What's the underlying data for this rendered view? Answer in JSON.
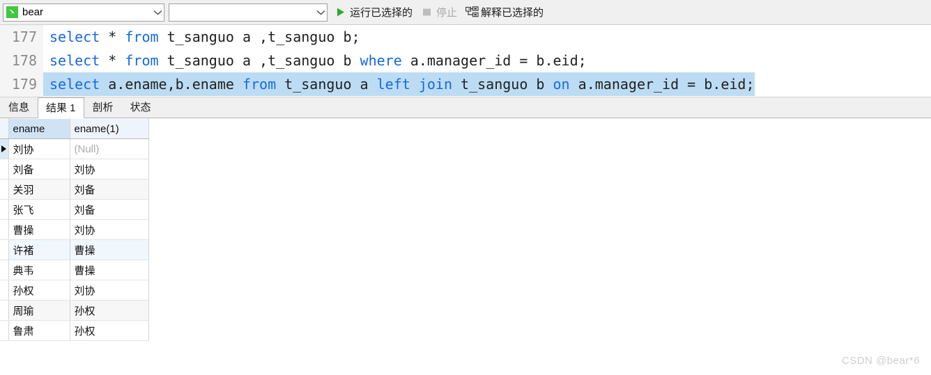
{
  "toolbar": {
    "connection": {
      "value": "bear",
      "icon": "dolphin-icon"
    },
    "database": {
      "value": "",
      "placeholder": ""
    },
    "run_selected": {
      "label": "运行已选择的",
      "icon": "play-icon"
    },
    "stop": {
      "label": "停止",
      "icon": "stop-icon",
      "disabled": true
    },
    "explain_selected": {
      "label": "解释已选择的",
      "icon": "explain-plan-icon"
    }
  },
  "editor": {
    "lines": [
      {
        "number": "177",
        "selected": false,
        "tokens": [
          {
            "t": "select",
            "k": true
          },
          {
            "t": " * ",
            "k": false
          },
          {
            "t": "from",
            "k": true
          },
          {
            "t": " t_sanguo a ,t_sanguo b;",
            "k": false
          }
        ],
        "text": "select * from t_sanguo a ,t_sanguo b;"
      },
      {
        "number": "178",
        "selected": false,
        "tokens": [
          {
            "t": "select",
            "k": true
          },
          {
            "t": " * ",
            "k": false
          },
          {
            "t": "from",
            "k": true
          },
          {
            "t": " t_sanguo a ,t_sanguo b ",
            "k": false
          },
          {
            "t": "where",
            "k": true
          },
          {
            "t": " a.manager_id = b.eid;",
            "k": false
          }
        ],
        "text": "select * from t_sanguo a ,t_sanguo b where a.manager_id = b.eid;"
      },
      {
        "number": "179",
        "selected": true,
        "tokens": [
          {
            "t": "select",
            "k": true
          },
          {
            "t": " a.ename,b.ename ",
            "k": false
          },
          {
            "t": "from",
            "k": true
          },
          {
            "t": " t_sanguo a ",
            "k": false
          },
          {
            "t": "left",
            "k": true
          },
          {
            "t": " ",
            "k": false
          },
          {
            "t": "join",
            "k": true
          },
          {
            "t": " t_sanguo b ",
            "k": false
          },
          {
            "t": "on",
            "k": true
          },
          {
            "t": " a.manager_id = b.eid;",
            "k": false
          }
        ],
        "text": "select a.ename,b.ename from t_sanguo a left join t_sanguo b on a.manager_id = b.eid;"
      }
    ]
  },
  "result_tabs": [
    {
      "label": "信息",
      "active": false
    },
    {
      "label": "结果 1",
      "active": true
    },
    {
      "label": "剖析",
      "active": false
    },
    {
      "label": "状态",
      "active": false
    }
  ],
  "grid": {
    "columns": [
      "ename",
      "ename(1)"
    ],
    "rows": [
      {
        "cells": [
          "刘协",
          "(Null)"
        ],
        "null_flags": [
          false,
          true
        ],
        "current": true,
        "stripe": "none"
      },
      {
        "cells": [
          "刘备",
          "刘协"
        ],
        "null_flags": [
          false,
          false
        ],
        "current": false,
        "stripe": "none"
      },
      {
        "cells": [
          "关羽",
          "刘备"
        ],
        "null_flags": [
          false,
          false
        ],
        "current": false,
        "stripe": "gray"
      },
      {
        "cells": [
          "张飞",
          "刘备"
        ],
        "null_flags": [
          false,
          false
        ],
        "current": false,
        "stripe": "none"
      },
      {
        "cells": [
          "曹操",
          "刘协"
        ],
        "null_flags": [
          false,
          false
        ],
        "current": false,
        "stripe": "none"
      },
      {
        "cells": [
          "许褚",
          "曹操"
        ],
        "null_flags": [
          false,
          false
        ],
        "current": false,
        "stripe": "blue"
      },
      {
        "cells": [
          "典韦",
          "曹操"
        ],
        "null_flags": [
          false,
          false
        ],
        "current": false,
        "stripe": "none"
      },
      {
        "cells": [
          "孙权",
          "刘协"
        ],
        "null_flags": [
          false,
          false
        ],
        "current": false,
        "stripe": "none"
      },
      {
        "cells": [
          "周瑜",
          "孙权"
        ],
        "null_flags": [
          false,
          false
        ],
        "current": false,
        "stripe": "gray"
      },
      {
        "cells": [
          "鲁肃",
          "孙权"
        ],
        "null_flags": [
          false,
          false
        ],
        "current": false,
        "stripe": "none"
      }
    ]
  },
  "watermark": {
    "text": "CSDN @bear*6"
  },
  "colors": {
    "keyword": "#1569e0",
    "selection": "#bcdcf4",
    "accent_green": "#3ec93e",
    "header_selected": "#cfe3f5"
  }
}
